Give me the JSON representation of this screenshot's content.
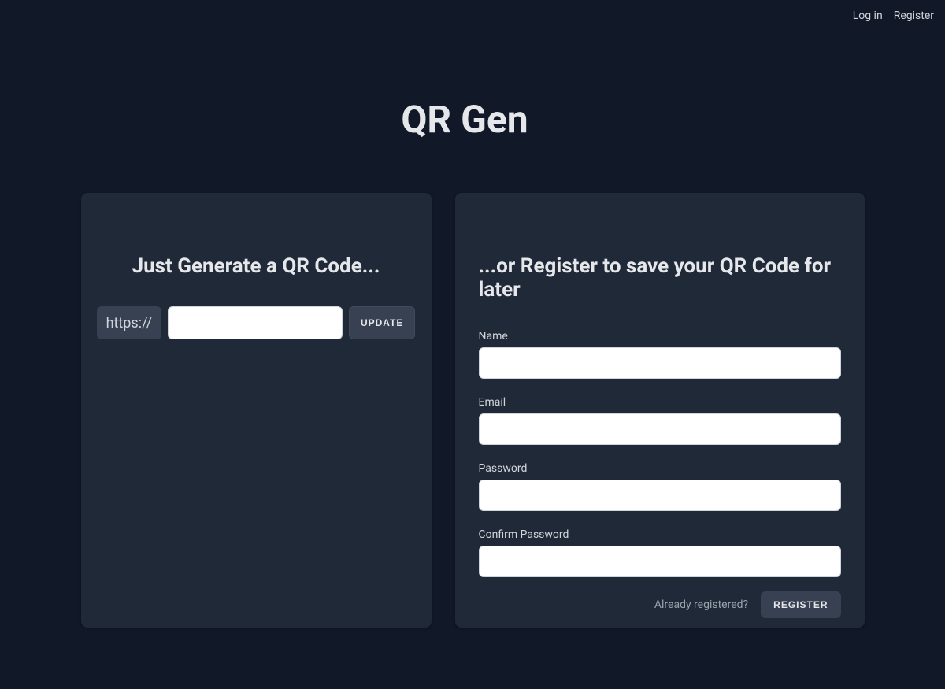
{
  "nav": {
    "login": "Log in",
    "register": "Register"
  },
  "title": "QR Gen",
  "generate": {
    "heading": "Just Generate a QR Code...",
    "prefix": "https://",
    "url_value": "",
    "update_label": "UPDATE"
  },
  "register": {
    "heading": "...or Register to save your QR Code for later",
    "name_label": "Name",
    "name_value": "",
    "email_label": "Email",
    "email_value": "",
    "password_label": "Password",
    "password_value": "",
    "confirm_label": "Confirm Password",
    "confirm_value": "",
    "already_link": "Already registered?",
    "submit_label": "REGISTER"
  }
}
